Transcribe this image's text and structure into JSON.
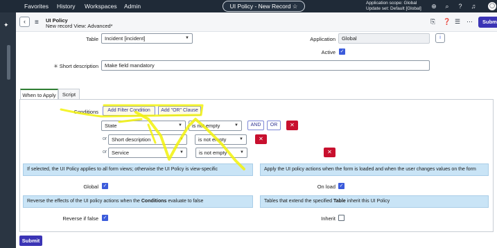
{
  "topnav": {
    "favorites": "Favorites",
    "history": "History",
    "workspaces": "Workspaces",
    "admin": "Admin",
    "title": "UI Policy - New Record ☆",
    "scope_line1": "Application scope: Global",
    "scope_line2": "Update set: Default [Global]"
  },
  "header": {
    "title": "UI Policy",
    "subtitle": "New record  View: Advanced*",
    "submit": "Submit"
  },
  "form": {
    "table_label": "Table",
    "table_value": "Incident [incident]",
    "application_label": "Application",
    "application_value": "Global",
    "active_label": "Active",
    "short_desc_label": "Short description",
    "short_desc_value": "Make field mandatory"
  },
  "tabs": {
    "when_to_apply": "When to Apply",
    "script": "Script"
  },
  "conditions": {
    "label": "Conditions",
    "add_filter": "Add Filter Condition",
    "add_or": "Add \"OR\" Clause",
    "rows": [
      {
        "field": "State",
        "operator": "is not empty"
      },
      {
        "prefix": "or",
        "field": "Short description",
        "operator": "is not empty"
      },
      {
        "prefix": "or",
        "field": "Service",
        "operator": "is not empty"
      }
    ],
    "and_btn": "AND",
    "or_btn": "OR"
  },
  "info": {
    "global_help": "If selected, the UI Policy applies to all form views; otherwise the UI Policy is view-specific",
    "global_label": "Global",
    "onload_help": "Apply the UI policy actions when the form is loaded and when the user changes values on the form",
    "onload_label": "On load",
    "reverse_help_pre": "Reverse the effects of the UI policy actions when the ",
    "reverse_help_bold": "Conditions",
    "reverse_help_post": " evaluate to false",
    "reverse_label": "Reverse if false",
    "inherit_help_pre": "Tables that extend the specified ",
    "inherit_help_bold": "Table",
    "inherit_help_post": " inherit this UI Policy",
    "inherit_label": "Inherit"
  },
  "footer": {
    "submit": "Submit"
  },
  "colors": {
    "nav_bg": "#1f2a37",
    "accent": "#3b34b5",
    "highlighter": "#f2f20a",
    "danger": "#c8102e",
    "info_bg": "#c9e4f6"
  }
}
